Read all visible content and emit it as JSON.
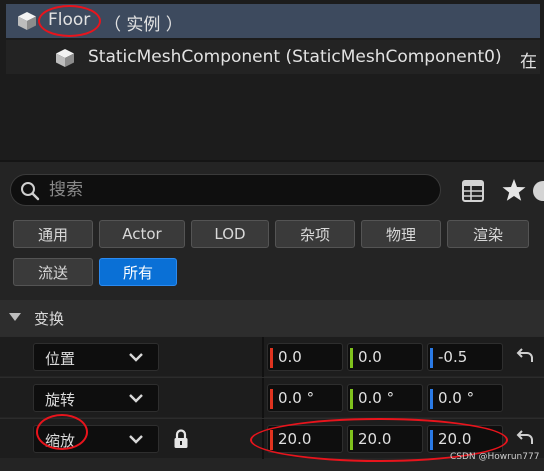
{
  "outliner": {
    "selected_item": {
      "name": "Floor",
      "type": "（ 实例 ）",
      "icon": "static-mesh-actor-icon"
    },
    "child_item": {
      "label": "StaticMeshComponent (StaticMeshComponent0)",
      "overflow_text": "在",
      "icon": "static-mesh-icon"
    }
  },
  "details": {
    "search": {
      "placeholder": "搜索",
      "value": ""
    },
    "toolbar_icons": [
      "table-view-icon",
      "favorites-star-icon",
      "settings-gear-icon"
    ],
    "filters": [
      {
        "label": "通用",
        "active": false
      },
      {
        "label": "Actor",
        "active": false
      },
      {
        "label": "LOD",
        "active": false
      },
      {
        "label": "杂项",
        "active": false
      },
      {
        "label": "物理",
        "active": false
      },
      {
        "label": "渲染",
        "active": false
      },
      {
        "label": "流送",
        "active": false
      },
      {
        "label": "所有",
        "active": true
      }
    ],
    "section": {
      "title": "变换",
      "expanded": true
    },
    "properties": [
      {
        "name": "位置",
        "values": [
          "0.0",
          "0.0",
          "-0.5"
        ],
        "locked": false
      },
      {
        "name": "旋转",
        "values": [
          "0.0 °",
          "0.0 °",
          "0.0 °"
        ],
        "locked": false
      },
      {
        "name": "缩放",
        "values": [
          "20.0",
          "20.0",
          "20.0"
        ],
        "locked": true
      }
    ],
    "axis_colors": {
      "x": "#e0331f",
      "y": "#7fc21c",
      "z": "#2a7ae6"
    }
  },
  "accent_color": "#0a70d6",
  "annotation_color": "#e8141c",
  "watermark": "CSDN @Howrun777"
}
